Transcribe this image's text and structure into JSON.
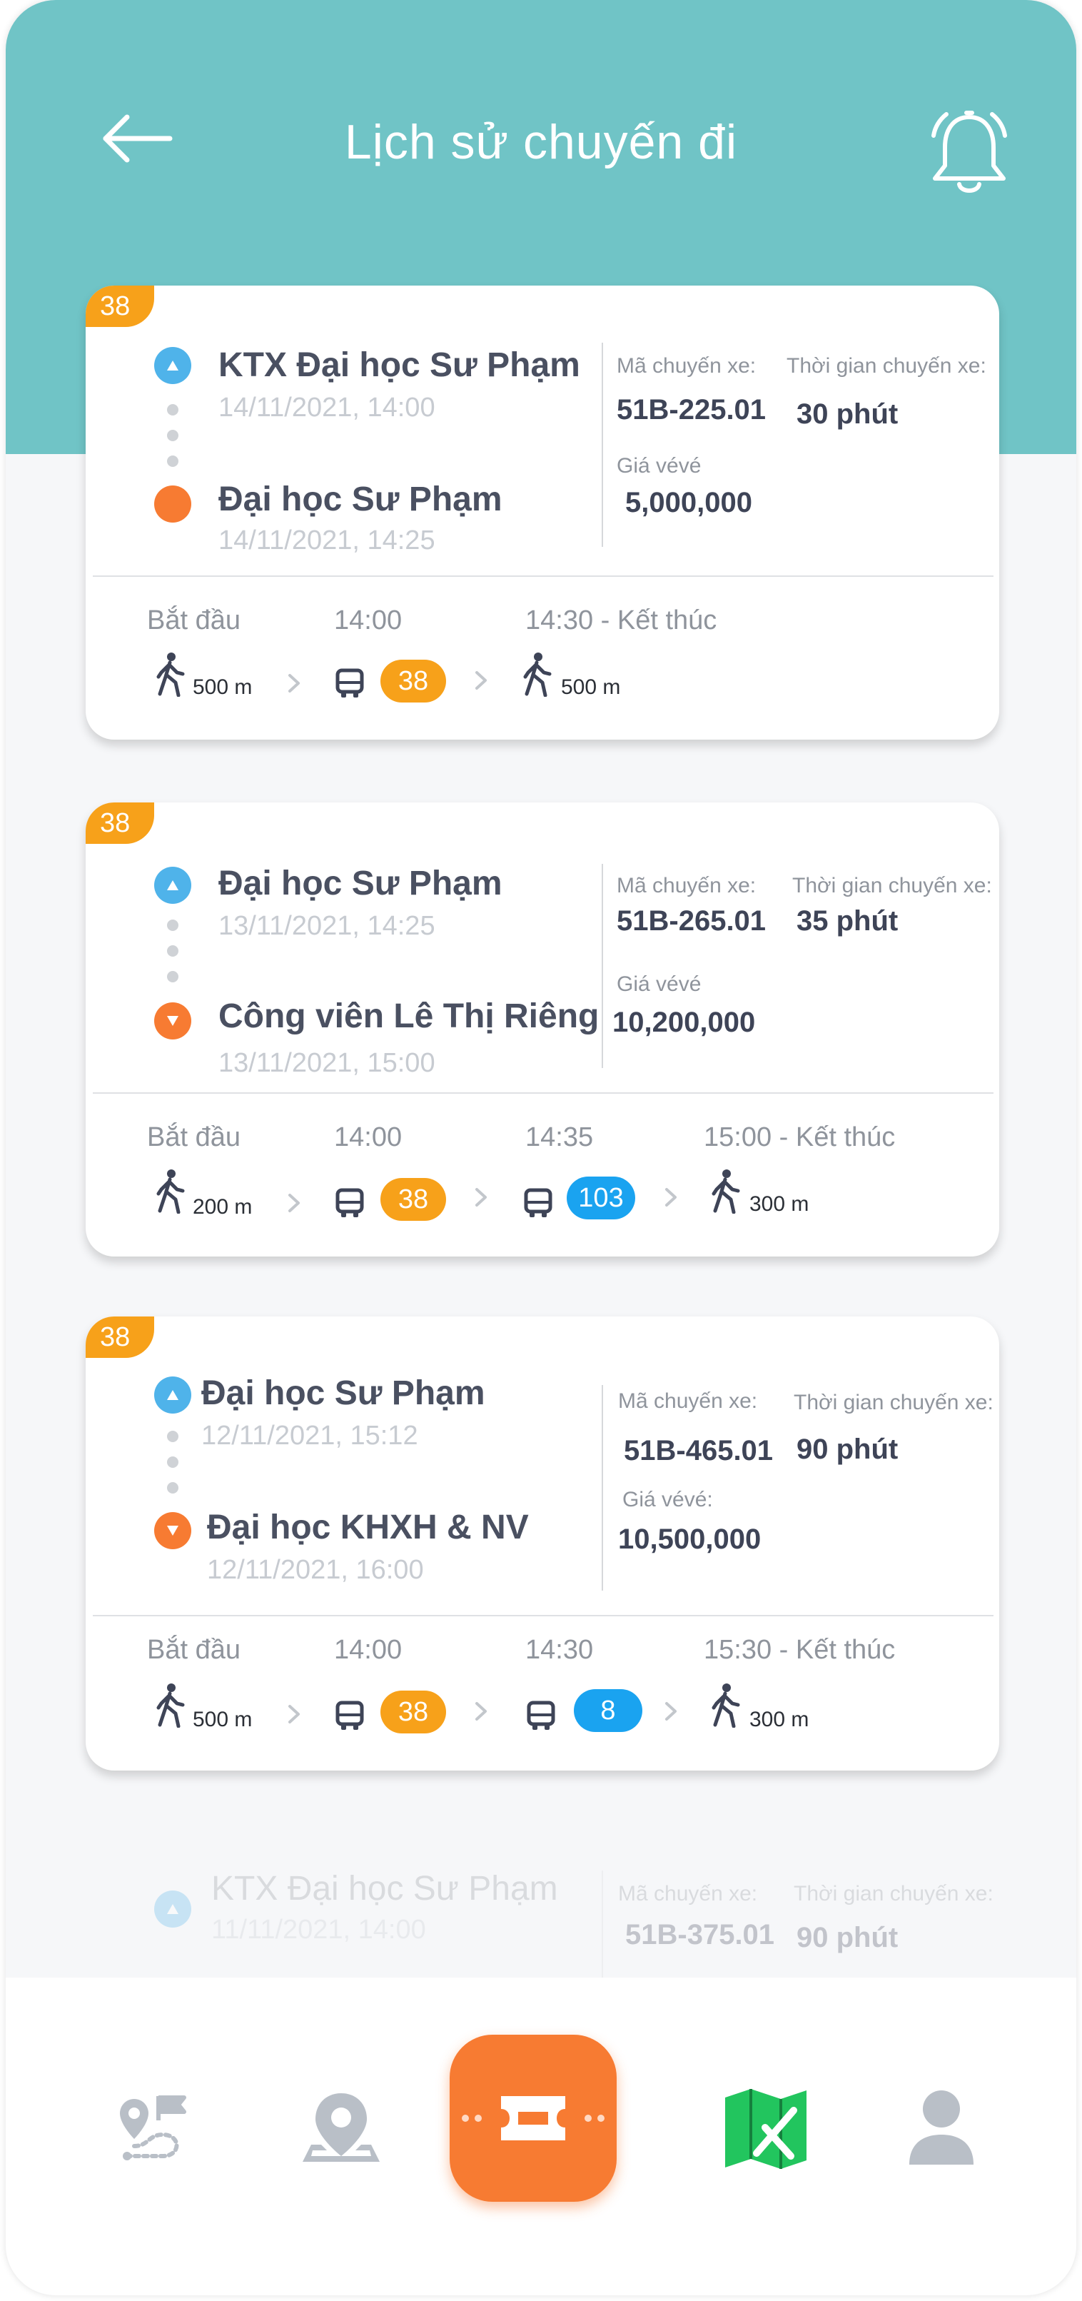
{
  "header": {
    "title": "Lịch sử chuyến đi"
  },
  "labels": {
    "trip_code": "Mã chuyến xe:",
    "trip_duration": "Thời gian chuyến xe:",
    "price": "Giá vévé",
    "price_colon": "Giá vévé:",
    "start": "Bắt đầu"
  },
  "trips": [
    {
      "tag": "38",
      "origin": "KTX Đại học Sư Phạm",
      "origin_time": "14/11/2021, 14:00",
      "destination": "Đại học Sư Phạm",
      "destination_time": "14/11/2021, 14:25",
      "trip_code": "51B-225.01",
      "duration": "30 phút",
      "price": "5,000,000",
      "timeline": {
        "t1": "14:00",
        "end": "14:30 - Kết thúc"
      },
      "walk_start": "500 m",
      "bus1": "38",
      "walk_end": "500 m"
    },
    {
      "tag": "38",
      "origin": "Đại học Sư Phạm",
      "origin_time": "13/11/2021, 14:25",
      "destination": "Công viên Lê Thị Riêng",
      "destination_time": "13/11/2021, 15:00",
      "trip_code": "51B-265.01",
      "duration": "35 phút",
      "price": "10,200,000",
      "timeline": {
        "t1": "14:00",
        "t2": "14:35",
        "end": "15:00 - Kết thúc"
      },
      "walk_start": "200 m",
      "bus1": "38",
      "bus2": "103",
      "walk_end": "300 m"
    },
    {
      "tag": "38",
      "origin": "Đại học Sư Phạm",
      "origin_time": "12/11/2021, 15:12",
      "destination": "Đại học KHXH & NV",
      "destination_time": "12/11/2021, 16:00",
      "trip_code": "51B-465.01",
      "duration": "90 phút",
      "price": "10,500,000",
      "timeline": {
        "t1": "14:00",
        "t2": "14:30",
        "end": "15:30 - Kết thúc"
      },
      "walk_start": "500 m",
      "bus1": "38",
      "bus2": "8",
      "walk_end": "300 m"
    },
    {
      "origin": "KTX Đại học Sư Phạm",
      "origin_time": "11/11/2021, 14:00",
      "trip_code": "51B-375.01",
      "duration": "90 phút"
    }
  ],
  "colors": {
    "header": "#70c4c6",
    "accent_orange": "#f77b32",
    "tag_orange": "#f7a11a",
    "origin_blue": "#4fb3ea",
    "bus_blue": "#1aa3f0"
  },
  "icons": {
    "back": "arrow-left-icon",
    "bell": "bell-icon",
    "walk": "walking-person-icon",
    "bus": "bus-icon",
    "chevron": "chevron-right-icon",
    "nav": [
      "route-icon",
      "location-pin-icon",
      "ticket-icon",
      "map-icon",
      "user-icon"
    ]
  }
}
